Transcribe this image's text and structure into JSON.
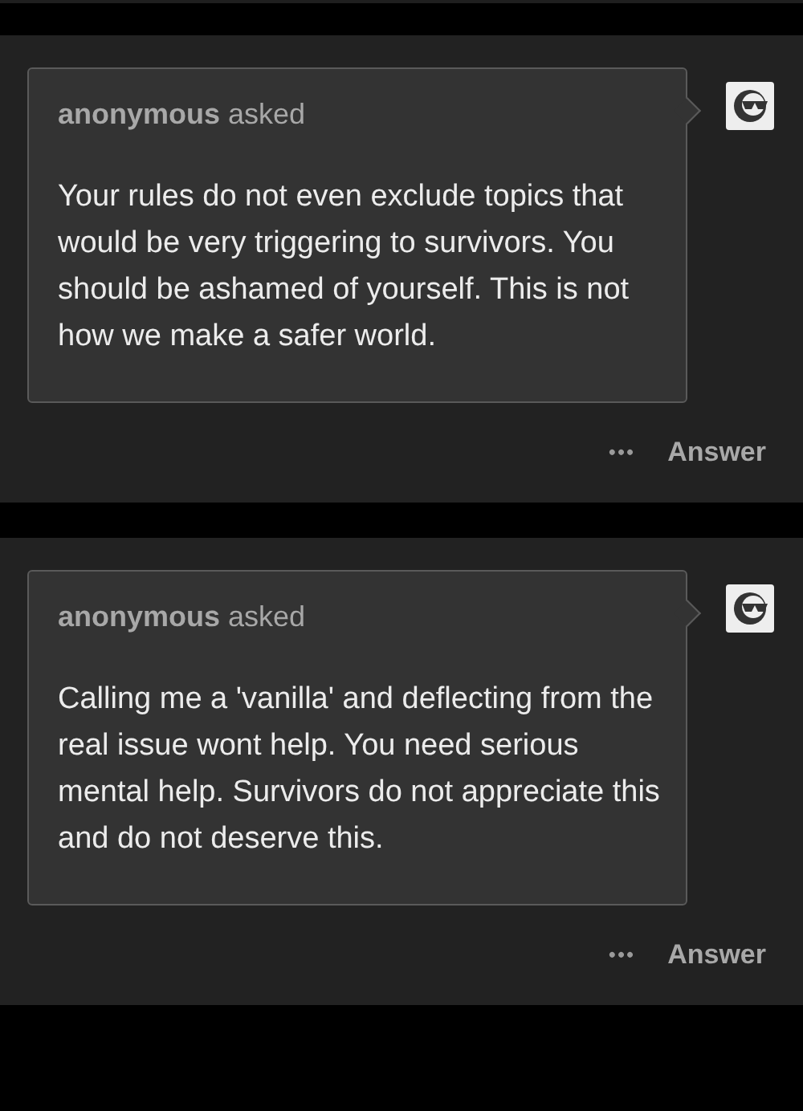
{
  "posts": [
    {
      "asker": "anonymous",
      "verb": "asked",
      "question": "Your rules do not even exclude topics that would be very triggering to survivors. You should be ashamed of yourself. This is not how we make a safer world.",
      "more": "•••",
      "answer": "Answer"
    },
    {
      "asker": "anonymous",
      "verb": "asked",
      "question": "Calling me a 'vanilla' and deflecting from the real issue wont help. You need serious mental help. Survivors do not appreciate this and do not deserve this.",
      "more": "•••",
      "answer": "Answer"
    }
  ]
}
